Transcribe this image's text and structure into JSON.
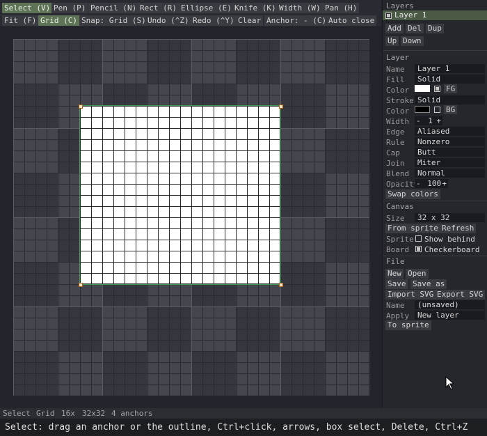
{
  "toolbar1": [
    "Select (V)",
    "Pen (P)",
    "Pencil (N)",
    "Rect (R)",
    "Ellipse (E)",
    "Knife (K)",
    "Width (W)",
    "Pan (H)"
  ],
  "toolbar2": [
    "Fit (F)",
    "Grid (C)",
    "Snap: Grid (S)",
    "Undo (^Z)",
    "Redo (^Y)",
    "Clear",
    "Anchor: - (C)",
    "Auto close"
  ],
  "layers": {
    "title": "Layers",
    "items": [
      "Layer 1"
    ],
    "buttons": [
      "Add",
      "Del",
      "Dup",
      "Up",
      "Down"
    ]
  },
  "layer_props": {
    "title": "Layer",
    "name_label": "Name",
    "name": "Layer 1",
    "fill_label": "Fill",
    "fill": "Solid",
    "color_label": "Color",
    "fill_color": "#ffffff",
    "fill_fg": "FG",
    "stroke_label": "Stroke",
    "stroke": "Solid",
    "stroke_color_label": "Color",
    "stroke_color": "#000000",
    "stroke_bg": "BG",
    "width_label": "Width",
    "width_minus": "-",
    "width": "1",
    "width_plus": "+",
    "edge_label": "Edge",
    "edge": "Aliased",
    "rule_label": "Rule",
    "rule": "Nonzero",
    "cap_label": "Cap",
    "cap": "Butt",
    "join_label": "Join",
    "join": "Miter",
    "blend_label": "Blend",
    "blend": "Normal",
    "opacity_label": "Opacity",
    "opacity_minus": "-",
    "opacity": "100",
    "opacity_plus": "+",
    "swap": "Swap colors"
  },
  "canvas": {
    "title": "Canvas",
    "size_label": "Size",
    "size": "32 x 32",
    "from_sprite": "From sprite",
    "refresh": "Refresh",
    "sprite_label": "Sprite",
    "show_behind": "Show behind",
    "board_label": "Board",
    "checkerboard": "Checkerboard"
  },
  "file": {
    "title": "File",
    "new": "New",
    "open": "Open",
    "save": "Save",
    "save_as": "Save as",
    "import_svg": "Import SVG",
    "export_svg": "Export SVG",
    "name_label": "Name",
    "name": "(unsaved)",
    "apply_label": "Apply",
    "apply": "New layer",
    "to_sprite": "To sprite"
  },
  "status": [
    "Select",
    "Grid",
    "16x",
    "32x32",
    "4 anchors"
  ],
  "hint": "Select: drag an anchor or the outline, Ctrl+click, arrows, box select, Delete, Ctrl+Z",
  "colors": {
    "accent": "#5f7357",
    "selection_outline": "#3c9a52"
  }
}
